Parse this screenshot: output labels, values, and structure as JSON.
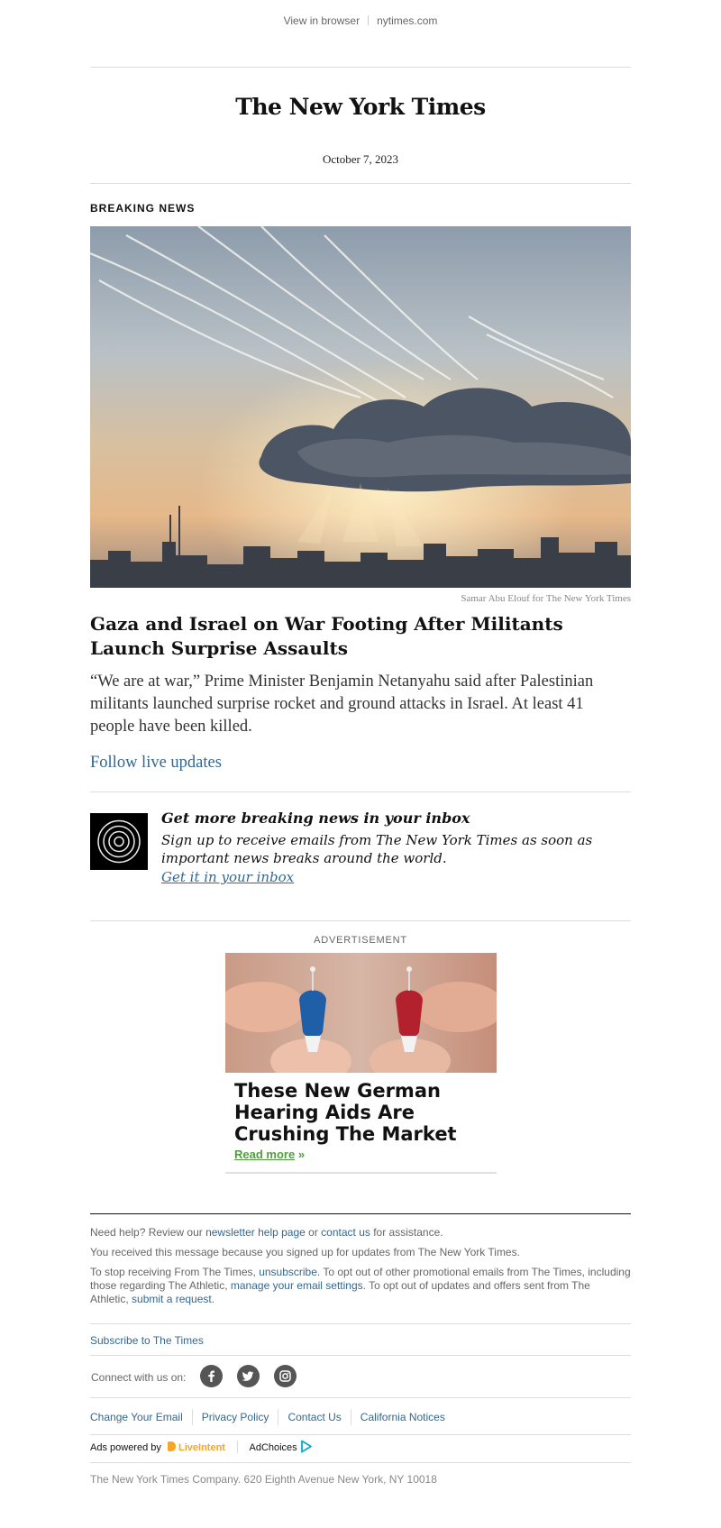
{
  "topbar": {
    "view_in_browser": "View in browser",
    "site": "nytimes.com"
  },
  "masthead": {
    "logo_text": "The New York Times",
    "date": "October 7, 2023"
  },
  "article": {
    "kicker": "BREAKING NEWS",
    "image_credit": "Samar Abu Elouf for The New York Times",
    "headline": "Gaza and Israel on War Footing After Militants Launch Surprise Assaults",
    "summary": "“We are at war,” Prime Minister Benjamin Netanyahu said after Palestinian militants launched surprise rocket and ground attacks in Israel. At least 41 people have been killed.",
    "cta": "Follow live updates"
  },
  "promo": {
    "title": "Get more breaking news in your inbox",
    "text": "Sign up to receive emails from The New York Times as soon as important news breaks around the world.",
    "link": "Get it in your inbox"
  },
  "ad": {
    "label": "ADVERTISEMENT",
    "title": "These New German Hearing Aids Are Crushing The Market",
    "read_more": "Read more",
    "read_more_arrow": "»"
  },
  "footer": {
    "help_prefix": "Need help? Review our ",
    "help_link1": "newsletter help page",
    "help_mid": " or ",
    "help_link2": "contact us",
    "help_suffix": " for assistance.",
    "received": "You received this message because you signed up for updates from The New York Times.",
    "stop_prefix": "To stop receiving From The Times, ",
    "stop_link1": "unsubscribe",
    "stop_mid1": ". To opt out of other promotional emails from The Times, including those regarding The Athletic, ",
    "stop_link2": "manage your email settings",
    "stop_mid2": ". To opt out of updates and offers sent from The Athletic, ",
    "stop_link3": "submit a request",
    "stop_suffix": ".",
    "subscribe": "Subscribe to The Times",
    "connect": "Connect with us on:",
    "links": [
      "Change Your Email",
      "Privacy Policy",
      "Contact Us",
      "California Notices"
    ],
    "ads_powered_by": "Ads powered by",
    "liveintent": "LiveIntent",
    "adchoices": "AdChoices",
    "address": "The New York Times Company. 620 Eighth Avenue New York, NY 10018"
  },
  "colors": {
    "link": "#326891",
    "rule": "#dcdcdc",
    "ad_green": "#4d9f3c",
    "liveintent": "#f5a623",
    "adchoices": "#00aecd"
  },
  "icons": [
    "facebook-icon",
    "twitter-icon",
    "instagram-icon",
    "adchoices-icon",
    "liveintent-icon",
    "concentric-circles-icon"
  ]
}
